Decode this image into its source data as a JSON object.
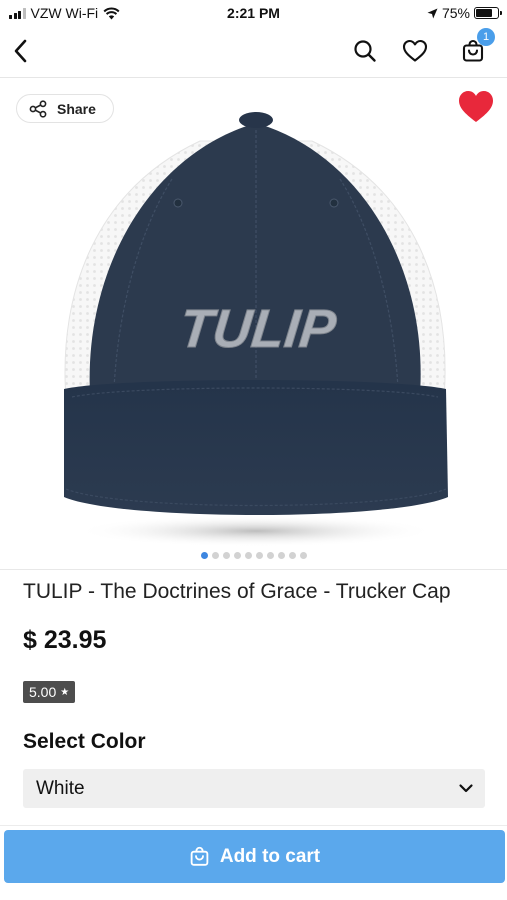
{
  "status_bar": {
    "carrier": "VZW Wi-Fi",
    "time": "2:21 PM",
    "battery": "75%",
    "battery_level": 0.75
  },
  "nav": {
    "back_icon": "chevron-left-icon",
    "search_icon": "search-icon",
    "wishlist_icon": "heart-outline-icon",
    "cart_icon": "shopping-bag-icon",
    "cart_count": "1"
  },
  "image": {
    "share_label": "Share",
    "cap_text": "TULIP",
    "slide_count": 10,
    "active_slide": 1
  },
  "product": {
    "title": "TULIP - The Doctrines of Grace - Trucker Cap",
    "price": "$ 23.95",
    "rating": "5.00",
    "rating_star": "★"
  },
  "options": {
    "select_label": "Select Color",
    "selected_color": "White"
  },
  "cta": {
    "add_to_cart_label": "Add to cart"
  },
  "colors": {
    "accent": "#5ba8ec",
    "badge": "#4a9eea",
    "heart": "#e8283b",
    "cap_navy": "#2c3a4e"
  }
}
